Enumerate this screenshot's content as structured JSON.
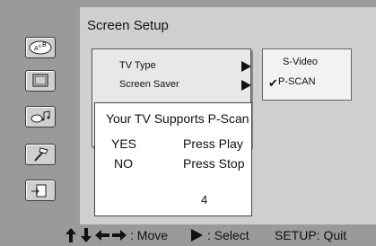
{
  "sidebar": {
    "icons": [
      {
        "name": "abc-bubble-icon"
      },
      {
        "name": "tv-icon"
      },
      {
        "name": "music-icon"
      },
      {
        "name": "hammer-icon"
      },
      {
        "name": "exit-icon"
      }
    ]
  },
  "header": {
    "title": "Screen Setup"
  },
  "menu": {
    "items": [
      {
        "label": "TV Type",
        "submenu": true
      },
      {
        "label": "Screen Saver",
        "submenu": true
      }
    ]
  },
  "options": {
    "items": [
      {
        "label": "S-Video",
        "selected": false
      },
      {
        "label": "P-SCAN",
        "selected": true
      }
    ],
    "check": "✔"
  },
  "dialog": {
    "message": "Your TV Supports P-Scan",
    "rows": [
      {
        "key": "YES",
        "action": "Press Play"
      },
      {
        "key": "NO",
        "action": "Press Stop"
      }
    ],
    "countdown": "4"
  },
  "footer": {
    "move": ": Move",
    "select": ": Select",
    "quit": "SETUP: Quit"
  }
}
